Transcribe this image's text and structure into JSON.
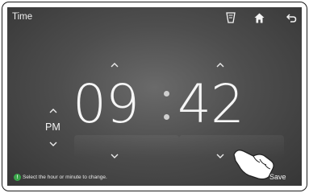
{
  "header": {
    "title": "Time",
    "icons": [
      "gallery-cup-icon",
      "home-icon",
      "back-icon"
    ]
  },
  "clock": {
    "hour": "09",
    "minute": "42",
    "period": "PM"
  },
  "footer": {
    "hint_text": "Select the hour or minute to change.",
    "save_label": "Save"
  },
  "colors": {
    "background": "#4a4a4a",
    "text": "#f6f6f6",
    "hint_icon": "#3aa64a"
  }
}
